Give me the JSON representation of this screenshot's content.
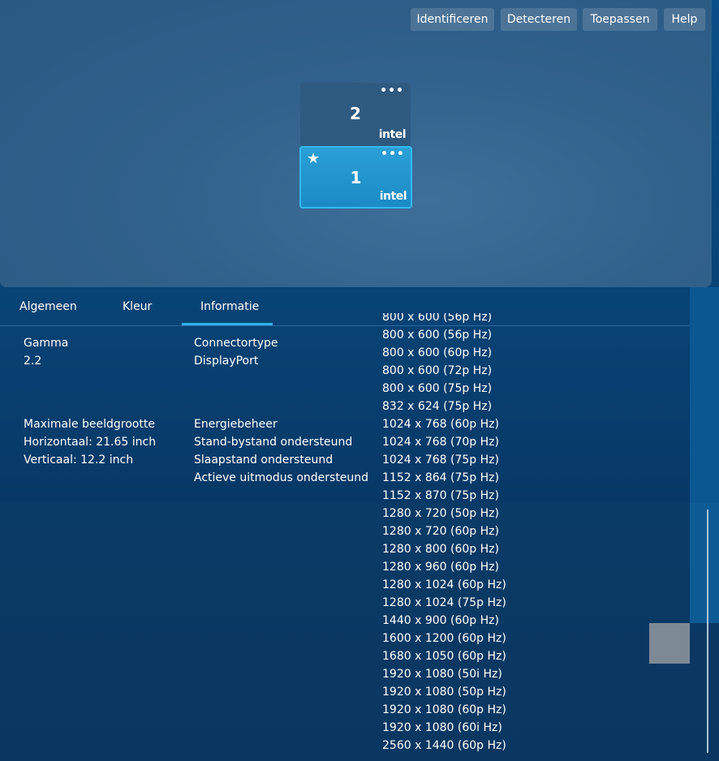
{
  "toolbar": {
    "identify": "Identificeren",
    "detect": "Detecteren",
    "apply": "Toepassen",
    "help": "Help"
  },
  "displays": [
    {
      "number": "2",
      "brand": "intel",
      "menu": "•••",
      "primary": false
    },
    {
      "number": "1",
      "brand": "intel",
      "menu": "•••",
      "primary": true,
      "primary_symbol": "★"
    }
  ],
  "tabs": [
    {
      "label": "Algemeen",
      "active": false
    },
    {
      "label": "Kleur",
      "active": false
    },
    {
      "label": "Informatie",
      "active": true
    }
  ],
  "info": {
    "gamma": {
      "label": "Gamma",
      "value": "2.2"
    },
    "connector": {
      "label": "Connectortype",
      "value": "DisplayPort"
    },
    "max_size": {
      "label": "Maximale beeldgrootte",
      "horizontal": "Horizontaal: 21.65 inch",
      "vertical": "Verticaal: 12.2 inch"
    },
    "power": {
      "label": "Energiebeheer",
      "items": [
        "Stand-bystand ondersteund",
        "Slaapstand ondersteund",
        "Actieve uitmodus ondersteund"
      ]
    }
  },
  "modes": [
    "800 x 600 (56p Hz)",
    "800 x 600 (60p Hz)",
    "800 x 600 (72p Hz)",
    "800 x 600 (75p Hz)",
    "832 x 624 (75p Hz)",
    "1024 x 768 (60p Hz)",
    "1024 x 768 (70p Hz)",
    "1024 x 768 (75p Hz)",
    "1152 x 864 (75p Hz)",
    "1152 x 870 (75p Hz)",
    "1280 x 720 (50p Hz)",
    "1280 x 720 (60p Hz)",
    "1280 x 800 (60p Hz)",
    "1280 x 960 (60p Hz)",
    "1280 x 1024 (60p Hz)",
    "1280 x 1024 (75p Hz)",
    "1440 x 900 (60p Hz)",
    "1600 x 1200 (60p Hz)",
    "1680 x 1050 (60p Hz)",
    "1920 x 1080 (50i Hz)",
    "1920 x 1080 (50p Hz)",
    "1920 x 1080 (60p Hz)",
    "1920 x 1080 (60i Hz)",
    "2560 x 1440 (60p Hz)"
  ],
  "colors": {
    "accent": "#2fb0ea",
    "primary_monitor": "#1b8bc6",
    "secondary_monitor": "#2f5a80",
    "button": "#4d7497"
  }
}
